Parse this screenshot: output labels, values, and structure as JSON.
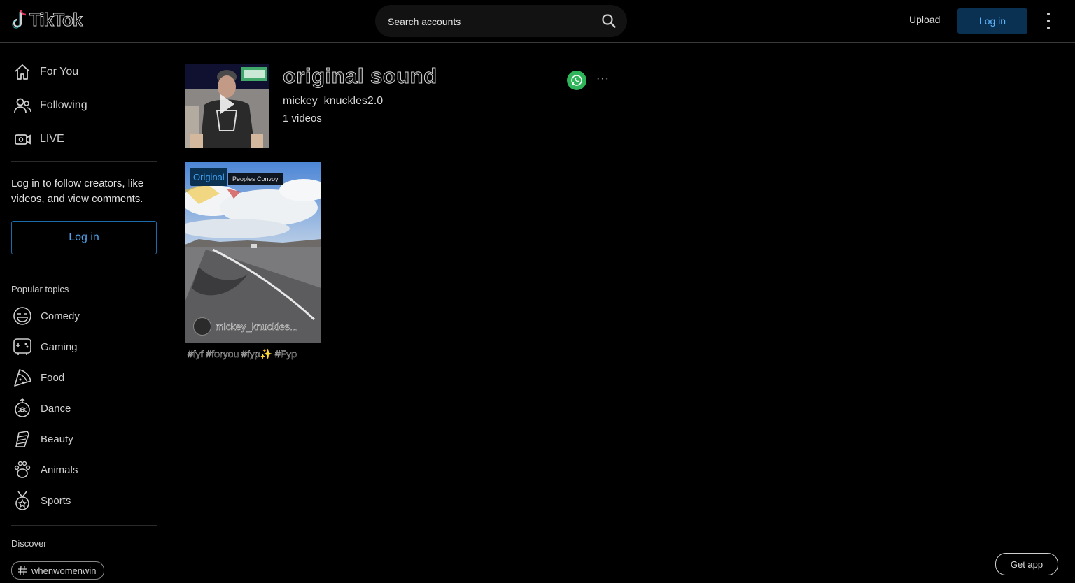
{
  "app": {
    "logo_text": "TikTok"
  },
  "header": {
    "search_placeholder": "Search accounts",
    "upload_label": "Upload",
    "login_label": "Log in"
  },
  "sidebar": {
    "nav": [
      {
        "label": "For You",
        "icon": "home-icon"
      },
      {
        "label": "Following",
        "icon": "users-icon"
      },
      {
        "label": "LIVE",
        "icon": "live-icon"
      }
    ],
    "promo_text": "Log in to follow creators, like videos, and view comments.",
    "login_label": "Log in",
    "popular_topics_title": "Popular topics",
    "topics": [
      {
        "label": "Comedy",
        "icon": "comedy-icon"
      },
      {
        "label": "Gaming",
        "icon": "gaming-icon"
      },
      {
        "label": "Food",
        "icon": "food-icon"
      },
      {
        "label": "Dance",
        "icon": "dance-icon"
      },
      {
        "label": "Beauty",
        "icon": "beauty-icon"
      },
      {
        "label": "Animals",
        "icon": "animals-icon"
      },
      {
        "label": "Sports",
        "icon": "sports-icon"
      }
    ],
    "discover_title": "Discover",
    "discover_tags": [
      "whenwomenwin"
    ]
  },
  "sound": {
    "title": "original sound",
    "author": "mickey_knuckles2.0",
    "video_count": "1 videos"
  },
  "videos": [
    {
      "badge": "Original",
      "overlay_text": "Peoples Convoy",
      "author": "mickey_knuckles...",
      "caption": "#fyf #foryou #fyp✨ #Fyp"
    }
  ],
  "footer": {
    "get_app_label": "Get app"
  },
  "colors": {
    "background": "#000000",
    "accent_blue": "#0a3152",
    "accent_blue_text": "#4fa6ee",
    "whatsapp_green": "#2fb45a"
  }
}
